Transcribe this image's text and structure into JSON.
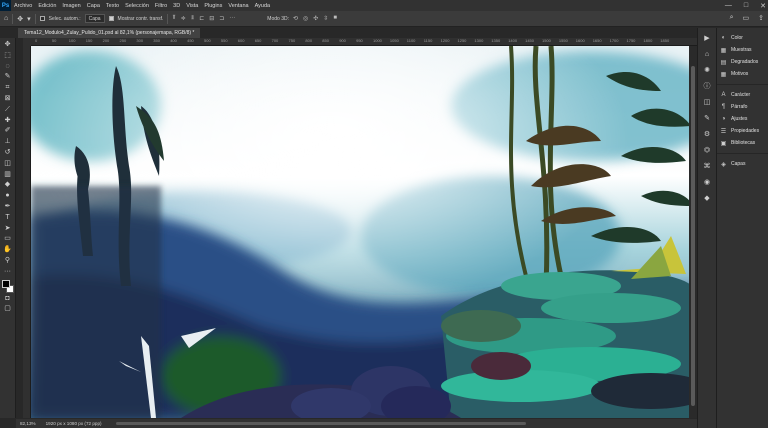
{
  "menubar": {
    "logo": "Ps",
    "items": [
      "Archivo",
      "Edición",
      "Imagen",
      "Capa",
      "Texto",
      "Selección",
      "Filtro",
      "3D",
      "Vista",
      "Plugins",
      "Ventana",
      "Ayuda"
    ],
    "window_controls": [
      "—",
      "□",
      "✕"
    ]
  },
  "options": {
    "auto_select_label": "Selec. autom.:",
    "auto_select_value": "Capa",
    "transform_label": "Mostrar contr. transf.",
    "mode_label": "Modo 3D:"
  },
  "document": {
    "tab_title": "Tema12_Modulo4_Zulay_Pulido_01.psd al 82,1% (personajemapa, RGB/8) *"
  },
  "ruler": {
    "h_ticks": [
      "0",
      "50",
      "100",
      "150",
      "200",
      "250",
      "300",
      "350",
      "400",
      "450",
      "500",
      "550",
      "600",
      "650",
      "700",
      "750",
      "800",
      "850",
      "900",
      "950",
      "1000",
      "1050",
      "1100",
      "1150",
      "1200",
      "1250",
      "1300",
      "1350",
      "1400",
      "1450",
      "1500",
      "1550",
      "1600",
      "1650",
      "1700",
      "1750",
      "1800",
      "1850"
    ]
  },
  "status": {
    "zoom": "82,13%",
    "doc_size": "1920 px x 1080 px (72 ppp)"
  },
  "panels": {
    "group1": [
      {
        "icon": "color-icon",
        "glyph": "◐",
        "label": "Color"
      },
      {
        "icon": "swatches-icon",
        "glyph": "▦",
        "label": "Muestras"
      },
      {
        "icon": "gradients-icon",
        "glyph": "▤",
        "label": "Degradados"
      },
      {
        "icon": "patterns-icon",
        "glyph": "▦",
        "label": "Motivos"
      }
    ],
    "group2": [
      {
        "icon": "character-icon",
        "glyph": "A",
        "label": "Carácter"
      },
      {
        "icon": "paragraph-icon",
        "glyph": "¶",
        "label": "Párrafo"
      },
      {
        "icon": "adjustments-icon",
        "glyph": "◑",
        "label": "Ajustes"
      },
      {
        "icon": "properties-icon",
        "glyph": "☰",
        "label": "Propiedades"
      },
      {
        "icon": "libraries-icon",
        "glyph": "▣",
        "label": "Bibliotecas"
      }
    ],
    "group3": [
      {
        "icon": "layers-icon",
        "glyph": "◈",
        "label": "Capas"
      }
    ]
  }
}
